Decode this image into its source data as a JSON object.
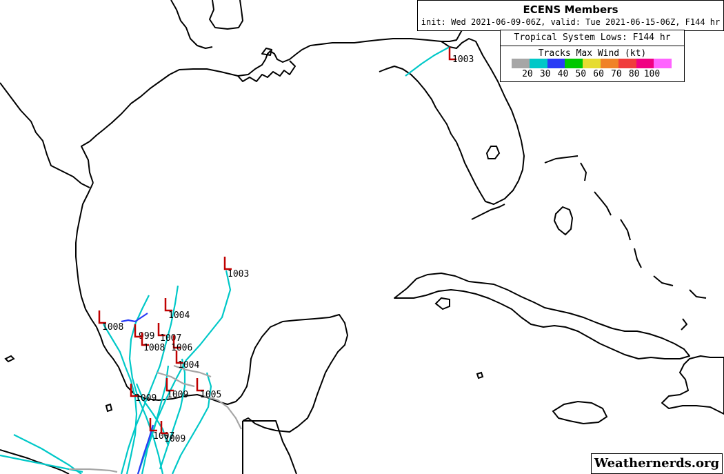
{
  "header": {
    "title": "ECENS Members",
    "subtitle": "init: Wed 2021-06-09-06Z, valid: Tue 2021-06-15-06Z, F144 hr"
  },
  "legend": {
    "title": "Tropical System Lows: F144 hr",
    "subtitle": "Tracks Max Wind (kt)",
    "bins": [
      {
        "color": "#a6a6a6"
      },
      {
        "color": "#00c8c8",
        "label": "20"
      },
      {
        "color": "#2a3cf5",
        "label": "30"
      },
      {
        "color": "#00c800",
        "label": "40"
      },
      {
        "color": "#e6dc32",
        "label": "50"
      },
      {
        "color": "#f08228",
        "label": "60"
      },
      {
        "color": "#f03c3c",
        "label": "70"
      },
      {
        "color": "#f00082",
        "label": "80"
      },
      {
        "color": "#ff64ff",
        "label": "100"
      }
    ]
  },
  "lows": [
    {
      "pressure": "1003",
      "color": "#c00000"
    },
    {
      "pressure": "1003",
      "color": "#c00000"
    },
    {
      "pressure": "1004",
      "color": "#c00000"
    },
    {
      "pressure": "1008",
      "color": "#c00000"
    },
    {
      "pressure": "999",
      "color": "#c00000"
    },
    {
      "pressure": "1007",
      "color": "#c00000"
    },
    {
      "pressure": "1008",
      "color": "#c00000"
    },
    {
      "pressure": "1006",
      "color": "#c00000"
    },
    {
      "pressure": "1004",
      "color": "#c00000"
    },
    {
      "pressure": "1009",
      "color": "#c00000"
    },
    {
      "pressure": "1009",
      "color": "#c00000"
    },
    {
      "pressure": "1005",
      "color": "#c00000"
    },
    {
      "pressure": "1007",
      "color": "#c00000"
    },
    {
      "pressure": "1009",
      "color": "#c00000"
    }
  ],
  "track_colors": {
    "cyan": "#00c8c8",
    "blue": "#2a3cf5",
    "gray": "#a6a6a6"
  },
  "brand": "Weathernerds.org"
}
